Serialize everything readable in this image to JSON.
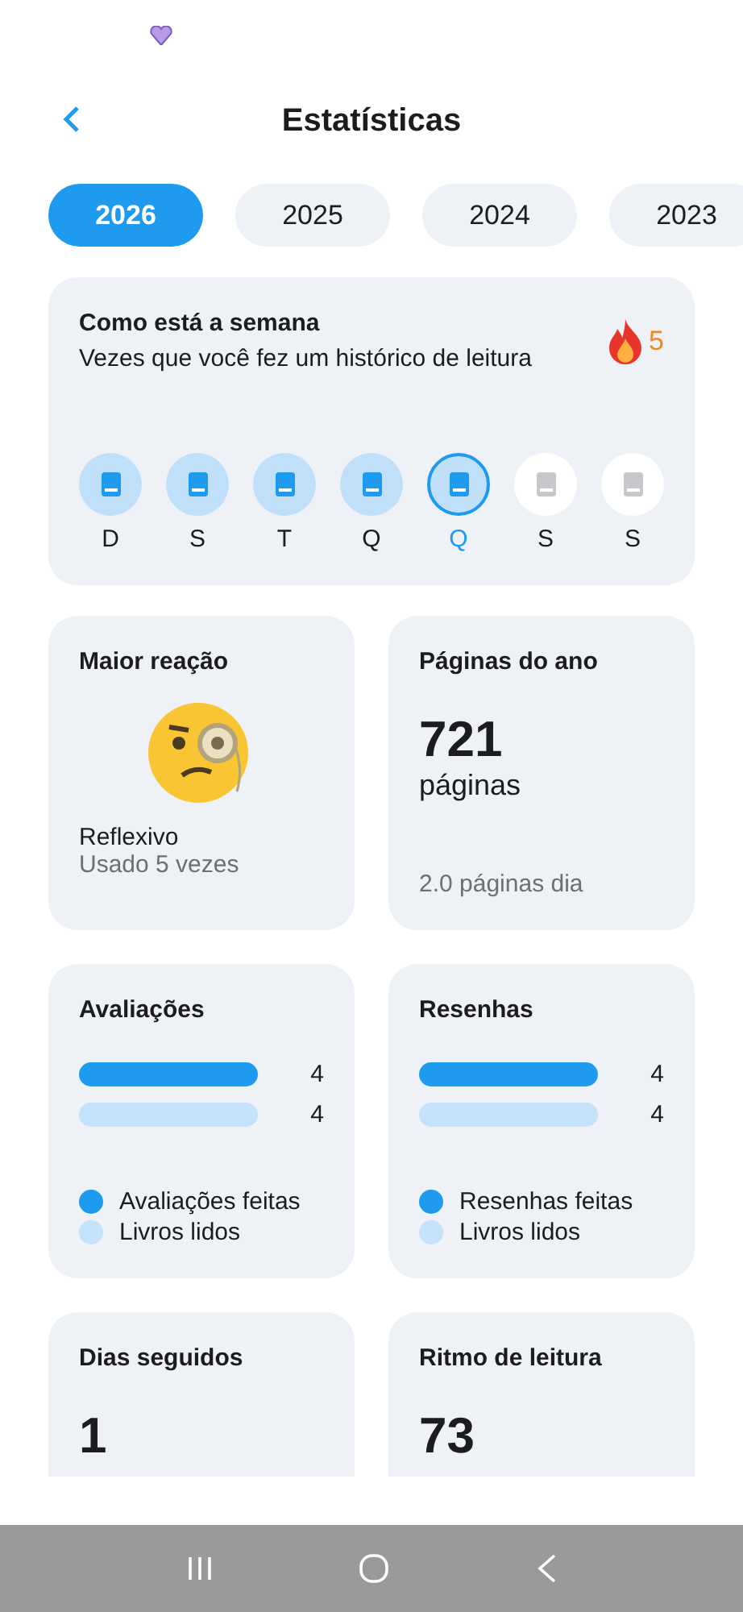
{
  "header": {
    "title": "Estatísticas"
  },
  "years": [
    {
      "label": "2026",
      "selected": true
    },
    {
      "label": "2025",
      "selected": false
    },
    {
      "label": "2024",
      "selected": false
    },
    {
      "label": "2023",
      "selected": false
    }
  ],
  "week": {
    "title": "Como está a semana",
    "subtitle": "Vezes que você fez um histórico de leitura",
    "streak": "5",
    "days": [
      {
        "label": "D",
        "read": true,
        "current": false
      },
      {
        "label": "S",
        "read": true,
        "current": false
      },
      {
        "label": "T",
        "read": true,
        "current": false
      },
      {
        "label": "Q",
        "read": true,
        "current": false
      },
      {
        "label": "Q",
        "read": true,
        "current": true
      },
      {
        "label": "S",
        "read": false,
        "current": false
      },
      {
        "label": "S",
        "read": false,
        "current": false
      }
    ]
  },
  "reaction": {
    "title": "Maior reação",
    "name": "Reflexivo",
    "usage": "Usado 5 vezes"
  },
  "pages": {
    "title": "Páginas do ano",
    "value": "721",
    "unit": "páginas",
    "per_day": "2.0 páginas dia"
  },
  "comparisons": [
    {
      "title": "Avaliações",
      "bars": [
        {
          "value": "4",
          "color": "#1e9bef"
        },
        {
          "value": "4",
          "color": "#c4e2f9"
        }
      ],
      "legend": [
        {
          "label": "Avaliações feitas",
          "color": "#1e9bef"
        },
        {
          "label": "Livros lidos",
          "color": "#c4e2f9"
        }
      ]
    },
    {
      "title": "Resenhas",
      "bars": [
        {
          "value": "4",
          "color": "#1e9bef"
        },
        {
          "value": "4",
          "color": "#c4e2f9"
        }
      ],
      "legend": [
        {
          "label": "Resenhas feitas",
          "color": "#1e9bef"
        },
        {
          "label": "Livros lidos",
          "color": "#c4e2f9"
        }
      ]
    }
  ],
  "counters": [
    {
      "title": "Dias seguidos",
      "value": "1"
    },
    {
      "title": "Ritmo de leitura",
      "value": "73"
    }
  ]
}
